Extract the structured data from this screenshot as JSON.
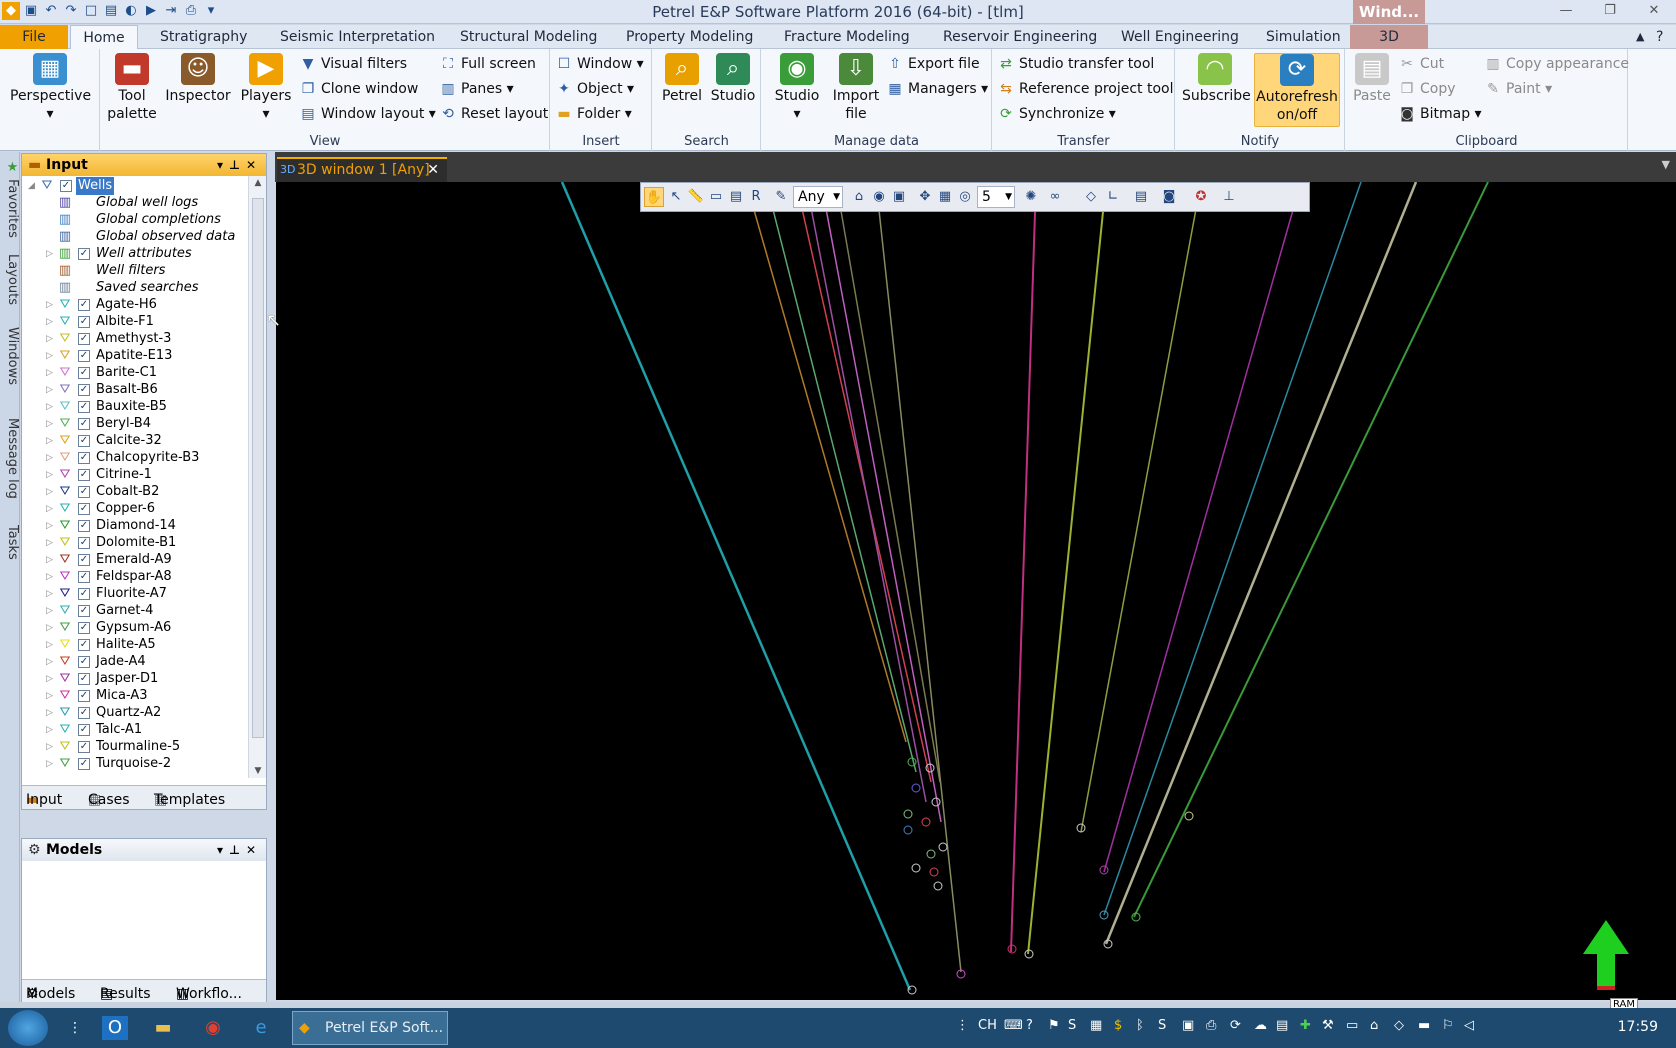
{
  "window": {
    "title": "Petrel E&P Software Platform 2016 (64-bit) - [tlm]",
    "context_tab": "Wind..."
  },
  "menu": {
    "file": "File",
    "home": "Home",
    "tabs": [
      "Stratigraphy",
      "Seismic Interpretation",
      "Structural Modeling",
      "Property Modeling",
      "Fracture Modeling",
      "Reservoir Engineering",
      "Well Engineering",
      "Simulation"
    ],
    "tab_3d": "3D"
  },
  "ribbon": {
    "perspective": "Perspective",
    "tool_palette": "Tool palette",
    "inspector": "Inspector",
    "players": "Players",
    "visual_filters": "Visual filters",
    "clone_window": "Clone window",
    "window_layout": "Window layout",
    "full_screen": "Full screen",
    "panes": "Panes",
    "reset_layout": "Reset layout",
    "view_label": "View",
    "window": "Window",
    "object": "Object",
    "folder": "Folder",
    "insert_label": "Insert",
    "petrel": "Petrel",
    "studio_search": "Studio",
    "search_label": "Search",
    "studio": "Studio",
    "import_file": "Import file",
    "export_file": "Export file",
    "managers": "Managers",
    "manage_label": "Manage data",
    "studio_transfer": "Studio transfer tool",
    "reference_project": "Reference project tool",
    "synchronize": "Synchronize",
    "transfer_label": "Transfer",
    "subscribe": "Subscribe",
    "autorefresh": "Autorefresh on/off",
    "notify_label": "Notify",
    "paste": "Paste",
    "cut": "Cut",
    "copy": "Copy",
    "bitmap": "Bitmap",
    "copy_appearance": "Copy appearance",
    "paint": "Paint",
    "clipboard_label": "Clipboard"
  },
  "side_tabs": [
    "Favorites",
    "Layouts",
    "Windows",
    "Message log",
    "Tasks"
  ],
  "input_panel": {
    "title": "Input",
    "root": "Wells",
    "special_items": [
      "Global well logs",
      "Global completions",
      "Global observed data",
      "Well attributes",
      "Well filters",
      "Saved searches"
    ],
    "wells": [
      "Agate-H6",
      "Albite-F1",
      "Amethyst-3",
      "Apatite-E13",
      "Barite-C1",
      "Basalt-B6",
      "Bauxite-B5",
      "Beryl-B4",
      "Calcite-32",
      "Chalcopyrite-B3",
      "Citrine-1",
      "Cobalt-B2",
      "Copper-6",
      "Diamond-14",
      "Dolomite-B1",
      "Emerald-A9",
      "Feldspar-A8",
      "Fluorite-A7",
      "Garnet-4",
      "Gypsum-A6",
      "Halite-A5",
      "Jade-A4",
      "Jasper-D1",
      "Mica-A3",
      "Quartz-A2",
      "Talc-A1",
      "Tourmaline-5",
      "Turquoise-2"
    ],
    "tabs": [
      "Input",
      "Cases",
      "Templates"
    ]
  },
  "models_panel": {
    "title": "Models",
    "tabs": [
      "Models",
      "Results",
      "Workflo..."
    ]
  },
  "doc_tab": {
    "title": "3D window 1 [Any]"
  },
  "viewer_toolbar": {
    "domain_value": "Any",
    "zscale_value": "5"
  },
  "taskbar": {
    "app_label": "Petrel E&P Soft...",
    "lang": "CH",
    "time": "17:59"
  },
  "status": {
    "ram": "RAM"
  }
}
